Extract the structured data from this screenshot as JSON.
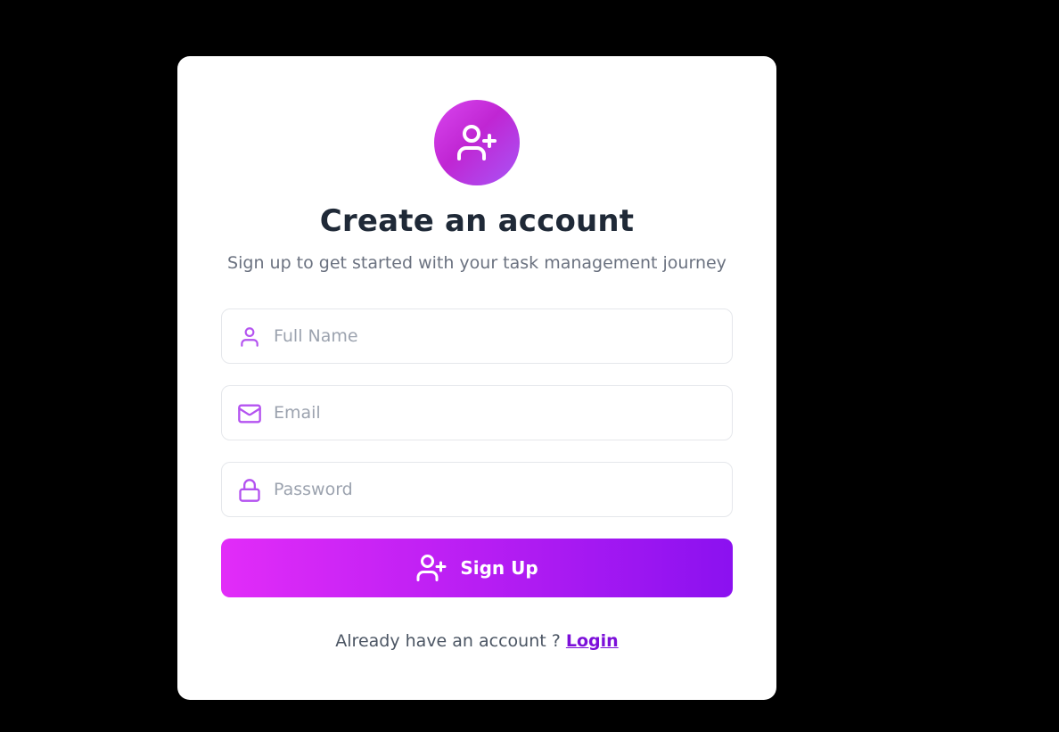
{
  "header": {
    "icon": "user-plus-icon",
    "title": "Create an account",
    "subtitle": "Sign up to get started with your task management journey"
  },
  "form": {
    "full_name": {
      "placeholder": "Full Name",
      "value": "",
      "icon": "user-icon"
    },
    "email": {
      "placeholder": "Email",
      "value": "",
      "icon": "mail-icon"
    },
    "password": {
      "placeholder": "Password",
      "value": "",
      "icon": "lock-icon"
    }
  },
  "signup_button": {
    "label": "Sign Up",
    "icon": "user-plus-icon"
  },
  "footer": {
    "prompt": "Already have an account ?",
    "login_link": "Login"
  },
  "colors": {
    "accent_start": "#e22cf8",
    "accent_end": "#8b11f0",
    "icon_purple": "#b453f0",
    "background": "#000000",
    "card": "#ffffff"
  }
}
